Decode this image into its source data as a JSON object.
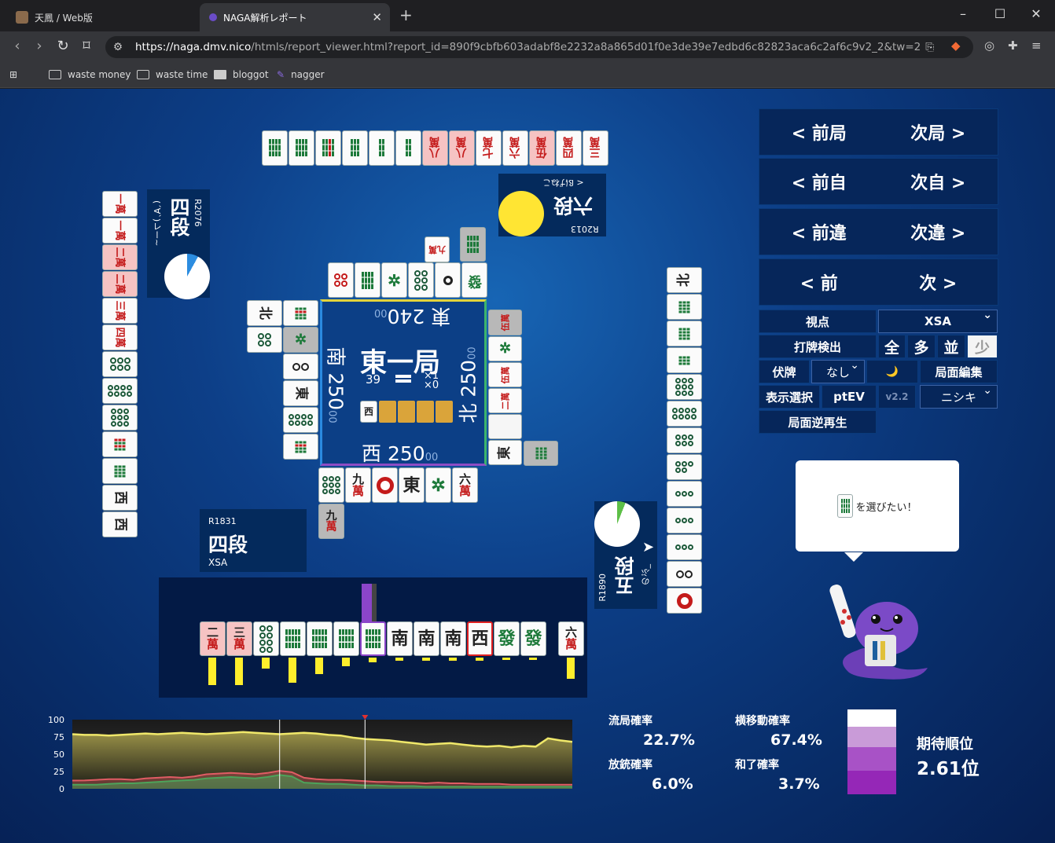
{
  "browser": {
    "tabs": [
      {
        "title": "天鳳 / Web版",
        "active": false
      },
      {
        "title": "NAGA解析レポート",
        "active": true
      }
    ],
    "url_host": "https://naga.dmv.nico",
    "url_rest": "/htmls/report_viewer.html?report_id=890f9cbfb603adabf8e2232a8a865d01f0e3de39e7edbd6c82823aca6c2af6c9v2_2&tw=2",
    "bookmarks": [
      "waste money",
      "waste time",
      "bloggot",
      "nagger"
    ]
  },
  "table": {
    "round": "東一局",
    "honba": "39",
    "riichi_sticks": "×1",
    "honba_sticks": "×0",
    "dora_indicator": "西",
    "seats": {
      "top": {
        "wind": "東",
        "score": "240",
        "suffix": "00"
      },
      "left": {
        "wind": "南",
        "score": "250",
        "suffix": "00"
      },
      "right": {
        "wind": "北",
        "score": "250",
        "suffix": "00"
      },
      "bottom": {
        "wind": "西",
        "score": "250",
        "suffix": "00"
      }
    }
  },
  "players": {
    "self": {
      "rating": "R1831",
      "rank": "四段",
      "name": "XSA"
    },
    "left": {
      "rating": "R2076",
      "rank": "四段",
      "name": "(´∀`)レー~"
    },
    "top": {
      "rating": "R2013",
      "rank": "六段",
      "name": "< ßげねこ"
    },
    "right": {
      "rating": "R1890",
      "rank": "五段",
      "name": "のぶ_"
    }
  },
  "controls": {
    "prev_round": "< 前局",
    "next_round": "次局 >",
    "prev_self": "< 前自",
    "next_self": "次自 >",
    "prev_diff": "< 前違",
    "next_diff": "次違 >",
    "prev": "< 前",
    "next": "次 >",
    "viewpoint_label": "視点",
    "viewpoint_value": "XSA",
    "discard_detect_label": "打牌検出",
    "filters": [
      "全",
      "多",
      "並",
      "少"
    ],
    "hidden_label": "伏牌",
    "hidden_value": "なし",
    "moon_icon": "🌙",
    "board_edit": "局面編集",
    "display_select": "表示選択",
    "ptev": "ptEV",
    "version": "v2.2",
    "model_value": "ニシキ",
    "reverse_play": "局面逆再生"
  },
  "bubble": {
    "text": "を選びたい！"
  },
  "stats": {
    "draw_label": "流局確率",
    "draw_value": "22.7%",
    "deal_in_label": "放銃確率",
    "deal_in_value": "6.0%",
    "lateral_label": "横移動確率",
    "lateral_value": "67.4%",
    "win_label": "和了確率",
    "win_value": "3.7%",
    "expected_rank_label": "期待順位",
    "expected_rank_value": "2.61位"
  },
  "chart_data": {
    "type": "area",
    "yticks": [
      "100",
      "75",
      "50",
      "25",
      "0"
    ],
    "ylim": [
      0,
      100
    ],
    "series": [
      {
        "values": [
          79,
          78,
          78,
          77,
          78,
          79,
          80,
          79,
          80,
          81,
          80,
          79,
          80,
          81,
          82,
          81,
          80,
          79,
          80,
          81,
          80,
          78,
          77,
          74,
          72,
          71,
          70,
          68,
          66,
          64,
          65,
          66,
          64,
          62,
          61,
          62,
          60,
          62,
          61,
          73,
          70,
          68
        ]
      },
      {
        "values": [
          12,
          12,
          13,
          14,
          14,
          13,
          15,
          16,
          17,
          16,
          18,
          21,
          22,
          23,
          22,
          21,
          23,
          26,
          24,
          16,
          14,
          13,
          13,
          12,
          11,
          10,
          10,
          9,
          9,
          8,
          9,
          8,
          8,
          7,
          7,
          7,
          6,
          6,
          6,
          6,
          6,
          6
        ]
      },
      {
        "values": [
          6,
          6,
          6,
          7,
          8,
          8,
          9,
          10,
          11,
          12,
          13,
          15,
          16,
          17,
          16,
          15,
          17,
          20,
          18,
          9,
          8,
          7,
          7,
          6,
          5,
          5,
          4,
          4,
          4,
          3,
          3,
          3,
          3,
          3,
          3,
          3,
          3,
          3,
          3,
          3,
          3,
          3
        ]
      }
    ],
    "markers": [
      17,
      24
    ],
    "colors": {
      "draw": "#f0e86a",
      "deal_in": "#e05c64",
      "win": "#4da35a"
    }
  },
  "hand": {
    "tiles": [
      "二萬",
      "三萬",
      "8p",
      "6s",
      "9s",
      "6s-a",
      "5s",
      "南",
      "南",
      "南",
      "西",
      "發",
      "發"
    ],
    "tsumo": "六萬",
    "bar_heights": [
      0.5,
      0.5,
      0.2,
      0.45,
      0.3,
      0.15,
      0.08,
      0.06,
      0.06,
      0.06,
      0.06,
      0.04,
      0.04,
      0.38
    ]
  }
}
